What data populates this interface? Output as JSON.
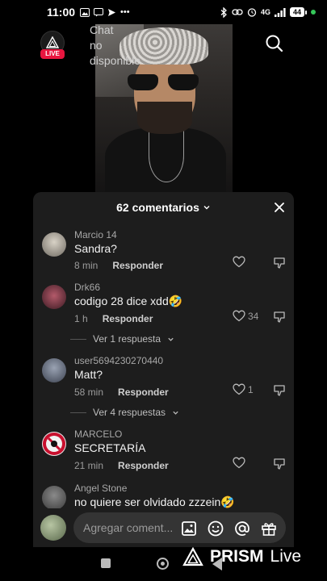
{
  "status_bar": {
    "time": "11:00",
    "network": "4G",
    "battery": "44"
  },
  "stream": {
    "chat_unavailable": "Chat no disponible",
    "live_badge": "LIVE"
  },
  "comments_panel": {
    "title": "62 comentarios",
    "reply_label": "Responder",
    "comments": [
      {
        "user": "Marcio 14",
        "text": "Sandra?",
        "time": "8 min",
        "likes": ""
      },
      {
        "user": "Drk66",
        "text": "codigo 28 dice xdd🤣",
        "time": "1 h",
        "likes": "34",
        "replies": "Ver 1 respuesta"
      },
      {
        "user": "user5694230270440",
        "text": "Matt?",
        "time": "58 min",
        "likes": "1",
        "replies": "Ver 4 respuestas"
      },
      {
        "user": "MARCELO",
        "text": "SECRETARÍA",
        "time": "21 min",
        "likes": ""
      },
      {
        "user": "Angel Stone",
        "text": "no quiere ser olvidado zzzein🤣"
      }
    ]
  },
  "input": {
    "placeholder": "Agregar coment..."
  },
  "watermark": {
    "brand": "PRISM",
    "suffix": "Live"
  },
  "colors": {
    "panel_bg": "#1d1d1d",
    "live_red": "#e8163f",
    "text_muted": "#9c9c9c"
  }
}
